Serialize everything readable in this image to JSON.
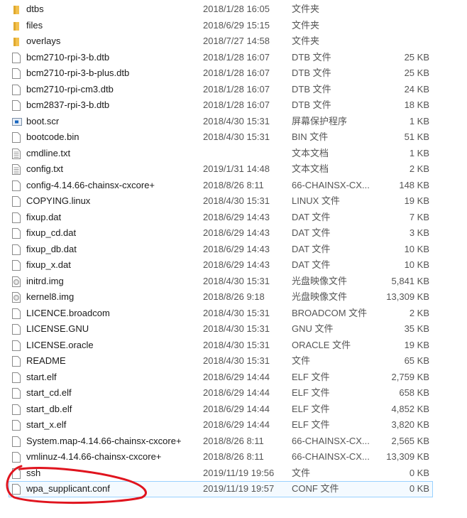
{
  "files": [
    {
      "name": "dtbs",
      "date": "2018/1/28 16:05",
      "type": "文件夹",
      "size": "",
      "icon": "folder-icon"
    },
    {
      "name": "files",
      "date": "2018/6/29 15:15",
      "type": "文件夹",
      "size": "",
      "icon": "folder-icon"
    },
    {
      "name": "overlays",
      "date": "2018/7/27 14:58",
      "type": "文件夹",
      "size": "",
      "icon": "folder-icon"
    },
    {
      "name": "bcm2710-rpi-3-b.dtb",
      "date": "2018/1/28 16:07",
      "type": "DTB 文件",
      "size": "25 KB",
      "icon": "file-icon"
    },
    {
      "name": "bcm2710-rpi-3-b-plus.dtb",
      "date": "2018/1/28 16:07",
      "type": "DTB 文件",
      "size": "25 KB",
      "icon": "file-icon"
    },
    {
      "name": "bcm2710-rpi-cm3.dtb",
      "date": "2018/1/28 16:07",
      "type": "DTB 文件",
      "size": "24 KB",
      "icon": "file-icon"
    },
    {
      "name": "bcm2837-rpi-3-b.dtb",
      "date": "2018/1/28 16:07",
      "type": "DTB 文件",
      "size": "18 KB",
      "icon": "file-icon"
    },
    {
      "name": "boot.scr",
      "date": "2018/4/30 15:31",
      "type": "屏幕保护程序",
      "size": "1 KB",
      "icon": "screensaver-icon"
    },
    {
      "name": "bootcode.bin",
      "date": "2018/4/30 15:31",
      "type": "BIN 文件",
      "size": "51 KB",
      "icon": "file-icon"
    },
    {
      "name": "cmdline.txt",
      "date": "",
      "type": "文本文档",
      "size": "1 KB",
      "icon": "text-file-icon"
    },
    {
      "name": "config.txt",
      "date": "2019/1/31 14:48",
      "type": "文本文档",
      "size": "2 KB",
      "icon": "text-file-icon"
    },
    {
      "name": "config-4.14.66-chainsx-cxcore+",
      "date": "2018/8/26 8:11",
      "type": "66-CHAINSX-CX...",
      "size": "148 KB",
      "icon": "file-icon"
    },
    {
      "name": "COPYING.linux",
      "date": "2018/4/30 15:31",
      "type": "LINUX 文件",
      "size": "19 KB",
      "icon": "file-icon"
    },
    {
      "name": "fixup.dat",
      "date": "2018/6/29 14:43",
      "type": "DAT 文件",
      "size": "7 KB",
      "icon": "file-icon"
    },
    {
      "name": "fixup_cd.dat",
      "date": "2018/6/29 14:43",
      "type": "DAT 文件",
      "size": "3 KB",
      "icon": "file-icon"
    },
    {
      "name": "fixup_db.dat",
      "date": "2018/6/29 14:43",
      "type": "DAT 文件",
      "size": "10 KB",
      "icon": "file-icon"
    },
    {
      "name": "fixup_x.dat",
      "date": "2018/6/29 14:43",
      "type": "DAT 文件",
      "size": "10 KB",
      "icon": "file-icon"
    },
    {
      "name": "initrd.img",
      "date": "2018/4/30 15:31",
      "type": "光盘映像文件",
      "size": "5,841 KB",
      "icon": "disc-image-icon"
    },
    {
      "name": "kernel8.img",
      "date": "2018/8/26 9:18",
      "type": "光盘映像文件",
      "size": "13,309 KB",
      "icon": "disc-image-icon"
    },
    {
      "name": "LICENCE.broadcom",
      "date": "2018/4/30 15:31",
      "type": "BROADCOM 文件",
      "size": "2 KB",
      "icon": "file-icon"
    },
    {
      "name": "LICENSE.GNU",
      "date": "2018/4/30 15:31",
      "type": "GNU 文件",
      "size": "35 KB",
      "icon": "file-icon"
    },
    {
      "name": "LICENSE.oracle",
      "date": "2018/4/30 15:31",
      "type": "ORACLE 文件",
      "size": "19 KB",
      "icon": "file-icon"
    },
    {
      "name": "README",
      "date": "2018/4/30 15:31",
      "type": "文件",
      "size": "65 KB",
      "icon": "file-icon"
    },
    {
      "name": "start.elf",
      "date": "2018/6/29 14:44",
      "type": "ELF 文件",
      "size": "2,759 KB",
      "icon": "file-icon"
    },
    {
      "name": "start_cd.elf",
      "date": "2018/6/29 14:44",
      "type": "ELF 文件",
      "size": "658 KB",
      "icon": "file-icon"
    },
    {
      "name": "start_db.elf",
      "date": "2018/6/29 14:44",
      "type": "ELF 文件",
      "size": "4,852 KB",
      "icon": "file-icon"
    },
    {
      "name": "start_x.elf",
      "date": "2018/6/29 14:44",
      "type": "ELF 文件",
      "size": "3,820 KB",
      "icon": "file-icon"
    },
    {
      "name": "System.map-4.14.66-chainsx-cxcore+",
      "date": "2018/8/26 8:11",
      "type": "66-CHAINSX-CX...",
      "size": "2,565 KB",
      "icon": "file-icon"
    },
    {
      "name": "vmlinuz-4.14.66-chainsx-cxcore+",
      "date": "2018/8/26 8:11",
      "type": "66-CHAINSX-CX...",
      "size": "13,309 KB",
      "icon": "file-icon"
    },
    {
      "name": "ssh",
      "date": "2019/11/19 19:56",
      "type": "文件",
      "size": "0 KB",
      "icon": "file-icon"
    },
    {
      "name": "wpa_supplicant.conf",
      "date": "2019/11/19 19:57",
      "type": "CONF 文件",
      "size": "0 KB",
      "icon": "file-icon",
      "selected": true
    }
  ],
  "colors": {
    "folder": "#f2c14e",
    "selection_border": "#99d1ff",
    "annotation": "#e0141e"
  }
}
